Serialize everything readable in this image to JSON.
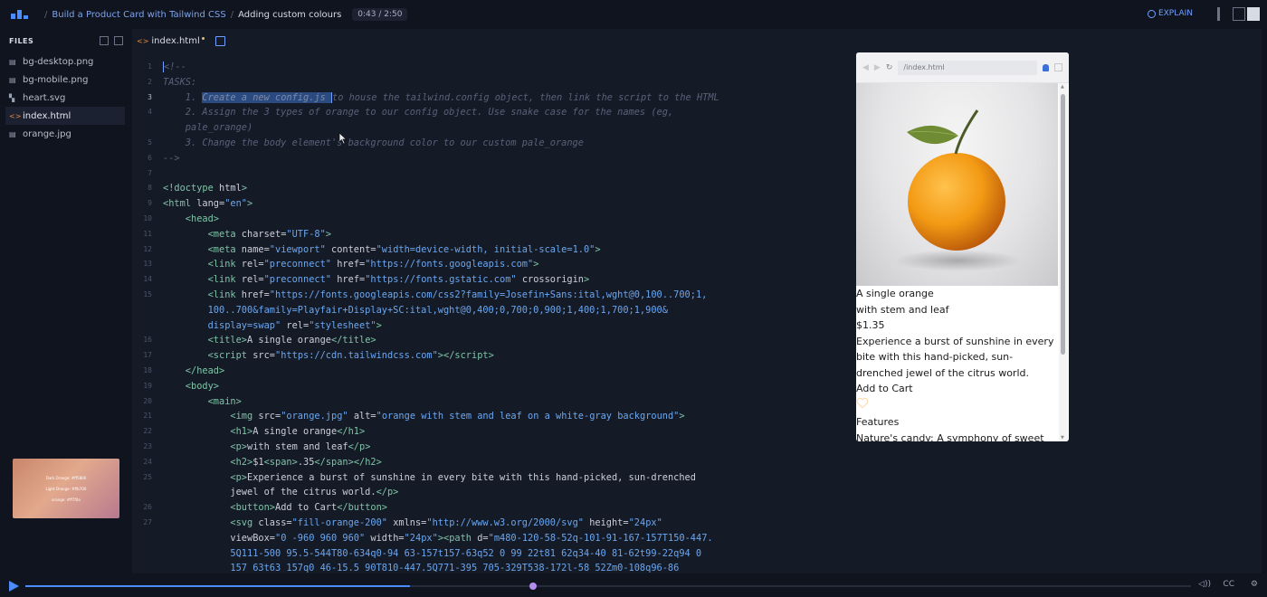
{
  "header": {
    "breadcrumb": [
      "Build a Product Card with Tailwind CSS",
      "Adding custom colours"
    ],
    "time": "0:43 / 2:50",
    "explain_label": "EXPLAIN"
  },
  "sidebar": {
    "title": "FILES",
    "files": [
      {
        "name": "bg-desktop.png",
        "icon": "image-icon",
        "active": false
      },
      {
        "name": "bg-mobile.png",
        "icon": "image-icon",
        "active": false
      },
      {
        "name": "heart.svg",
        "icon": "svg-icon",
        "active": false
      },
      {
        "name": "index.html",
        "icon": "code-icon",
        "active": true
      },
      {
        "name": "orange.jpg",
        "icon": "image-icon",
        "active": false
      }
    ],
    "thumbnail_lines": [
      "Dark Orange: #ff5800",
      "Light Orange: #ffb700",
      "orange: #ff7f0a"
    ]
  },
  "editor": {
    "tab_name": "index.html",
    "current_line": 3
  },
  "preview": {
    "url": "/index.html",
    "title": "A single orange",
    "subtitle": "with stem and leaf",
    "price": "$1.35",
    "description": "Experience a burst of sunshine in every bite with this hand-picked, sun-drenched jewel of the citrus world.",
    "button": "Add to Cart",
    "features_heading": "Features",
    "features_text": "Nature's candy: A symphony of sweet and"
  },
  "player": {
    "progress": 0.25,
    "buffered": 0.33
  },
  "colors": {
    "accent": "#4b8dff",
    "tag": "#7ec4a6",
    "string": "#6aa7f0",
    "comment": "#586178"
  }
}
